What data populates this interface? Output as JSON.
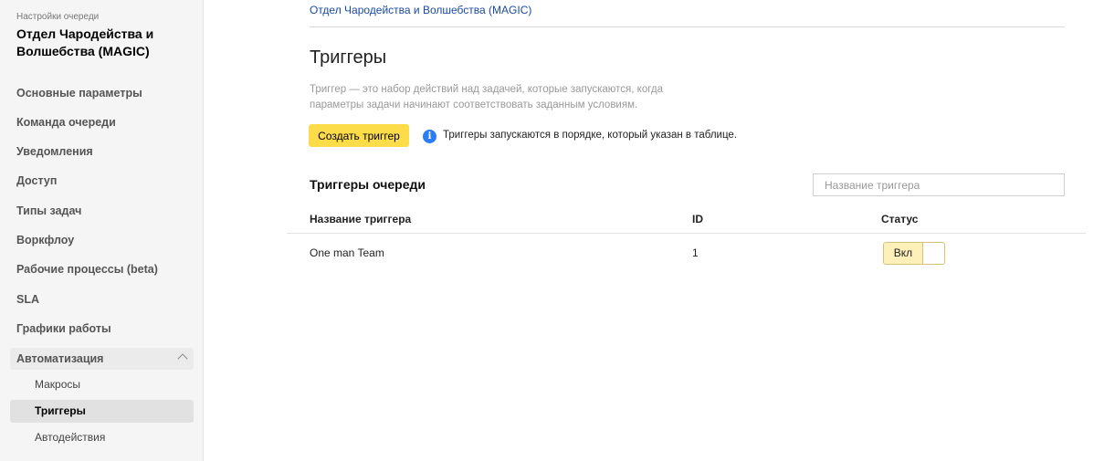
{
  "sidebar": {
    "caption": "Настройки очереди",
    "queue_title": "Отдел Чародейства и Волшебства (MAGIC)",
    "items": [
      {
        "label": "Основные параметры"
      },
      {
        "label": "Команда очереди"
      },
      {
        "label": "Уведомления"
      },
      {
        "label": "Доступ"
      },
      {
        "label": "Типы задач"
      },
      {
        "label": "Воркфлоу"
      },
      {
        "label": "Рабочие процессы (beta)"
      },
      {
        "label": "SLA"
      },
      {
        "label": "Графики работы"
      },
      {
        "label": "Автоматизация",
        "expanded": true
      }
    ],
    "sub_items": [
      {
        "label": "Макросы"
      },
      {
        "label": "Триггеры",
        "active": true
      },
      {
        "label": "Автодействия"
      }
    ]
  },
  "main": {
    "breadcrumb": "Отдел Чародейства и Волшебства (MAGIC)",
    "title": "Триггеры",
    "description": "Триггер — это набор действий над задачей, которые запускаются, когда параметры задачи начинают соответствовать заданным условиям.",
    "create_button": "Создать триггер",
    "info_icon": "i",
    "info_text": "Триггеры запускаются в порядке, который указан в таблице.",
    "section_title": "Триггеры очереди",
    "search_placeholder": "Название триггера",
    "table": {
      "columns": [
        "Название триггера",
        "ID",
        "Статус"
      ],
      "rows": [
        {
          "name": "One man Team",
          "id": "1",
          "status": "Вкл"
        }
      ]
    }
  },
  "colors": {
    "accent_button": "#fddc4a",
    "link": "#1a4aa0",
    "info": "#2a7cf7"
  }
}
